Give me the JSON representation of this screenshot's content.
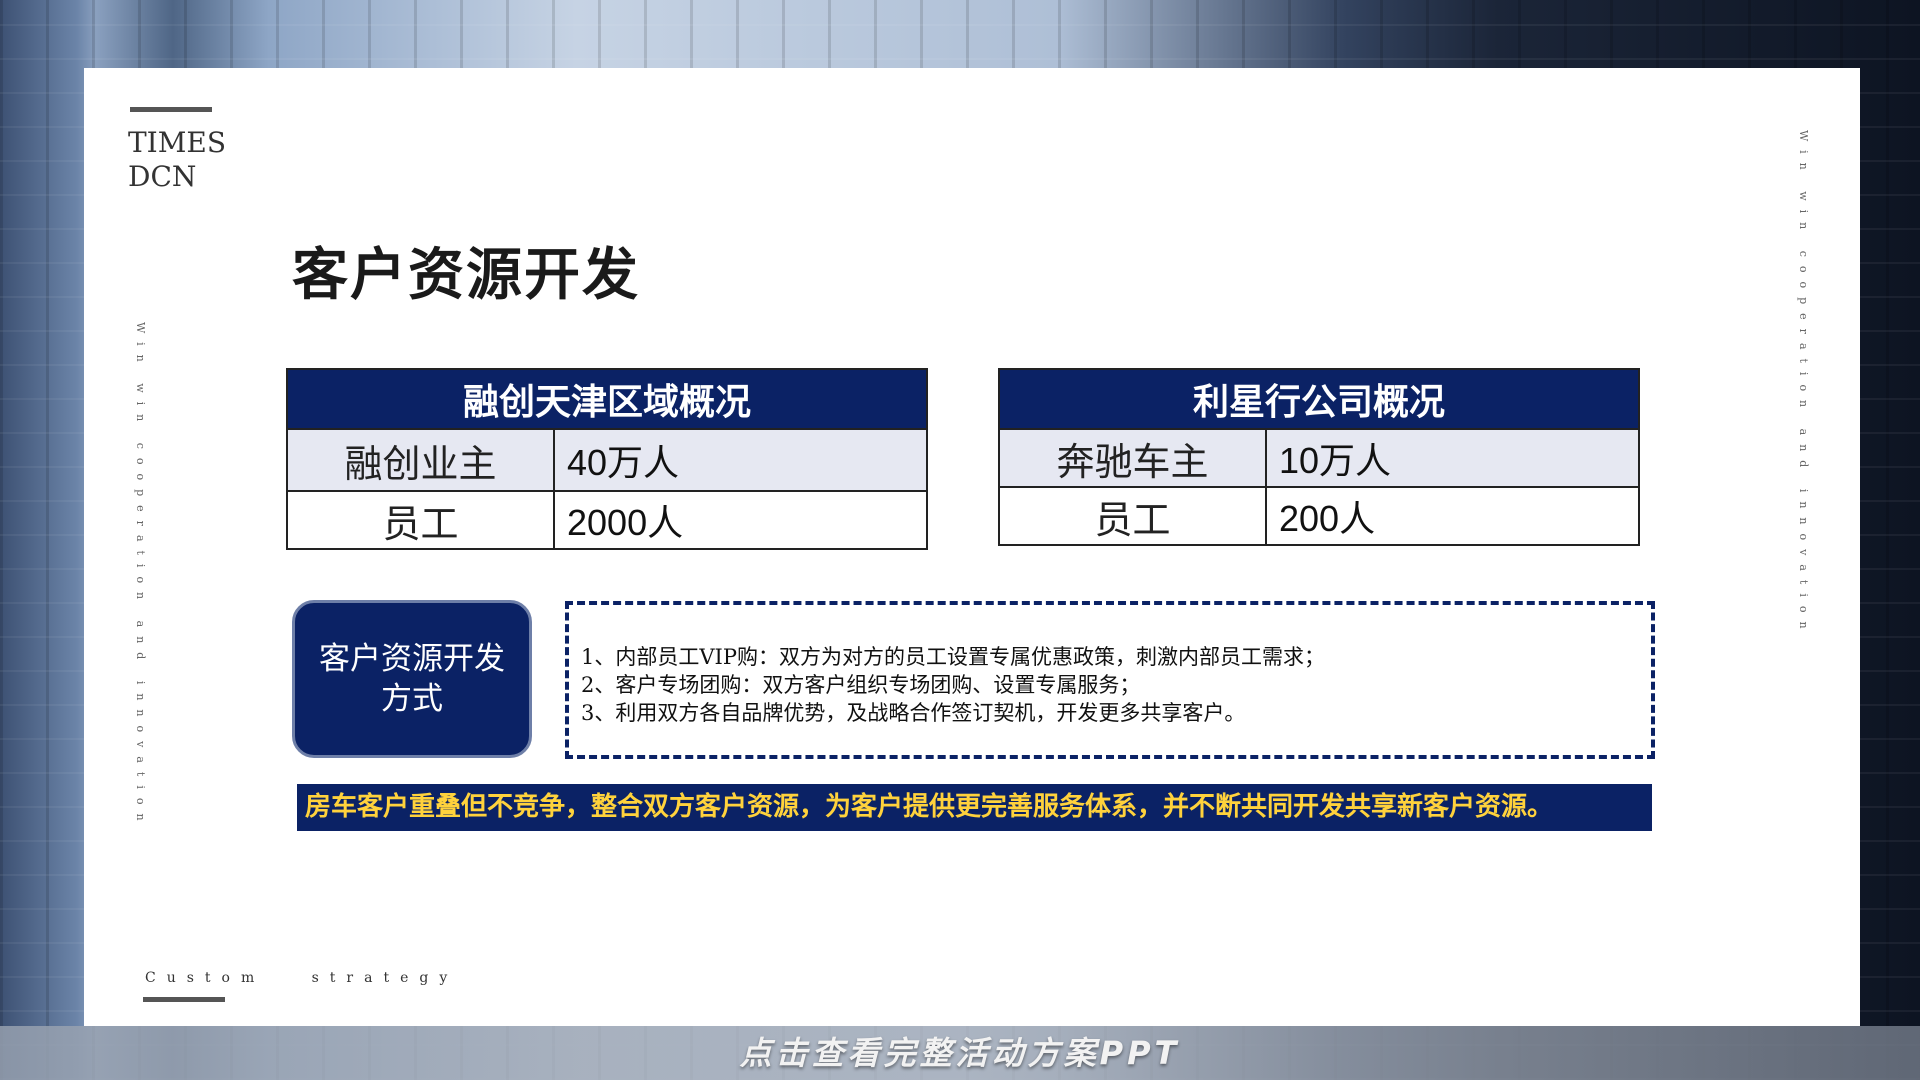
{
  "logo": {
    "line1": "TIMES",
    "line2": "DCN"
  },
  "side_text_left": "Win win cooperation and innovation",
  "side_text_right": "Win win cooperation and innovation",
  "footer_text": "Custom   strategy",
  "title": "客户资源开发",
  "table_left": {
    "header": "融创天津区域概况",
    "rows": [
      {
        "key": "融创业主",
        "value": "40万人"
      },
      {
        "key": "员工",
        "value": "2000人"
      }
    ]
  },
  "table_right": {
    "header": "利星行公司概况",
    "rows": [
      {
        "key": "奔驰车主",
        "value": "10万人"
      },
      {
        "key": "员工",
        "value": "200人"
      }
    ]
  },
  "method": {
    "label": "客户资源开发方式",
    "items": [
      "1、内部员工VIP购：双方为对方的员工设置专属优惠政策，刺激内部员工需求；",
      "2、客户专场团购：双方客户组织专场团购、设置专属服务；",
      "3、利用双方各自品牌优势，及战略合作签订契机，开发更多共享客户。"
    ]
  },
  "banner": "房车客户重叠但不竞争，整合双方客户资源，为客户提供更完善服务体系，并不断共同开发共享新客户资源。",
  "cta": "点击查看完整活动方案PPT",
  "colors": {
    "navy": "#0b2265",
    "banner_text": "#ffd23c",
    "row_shade": "#e6e8f2"
  }
}
